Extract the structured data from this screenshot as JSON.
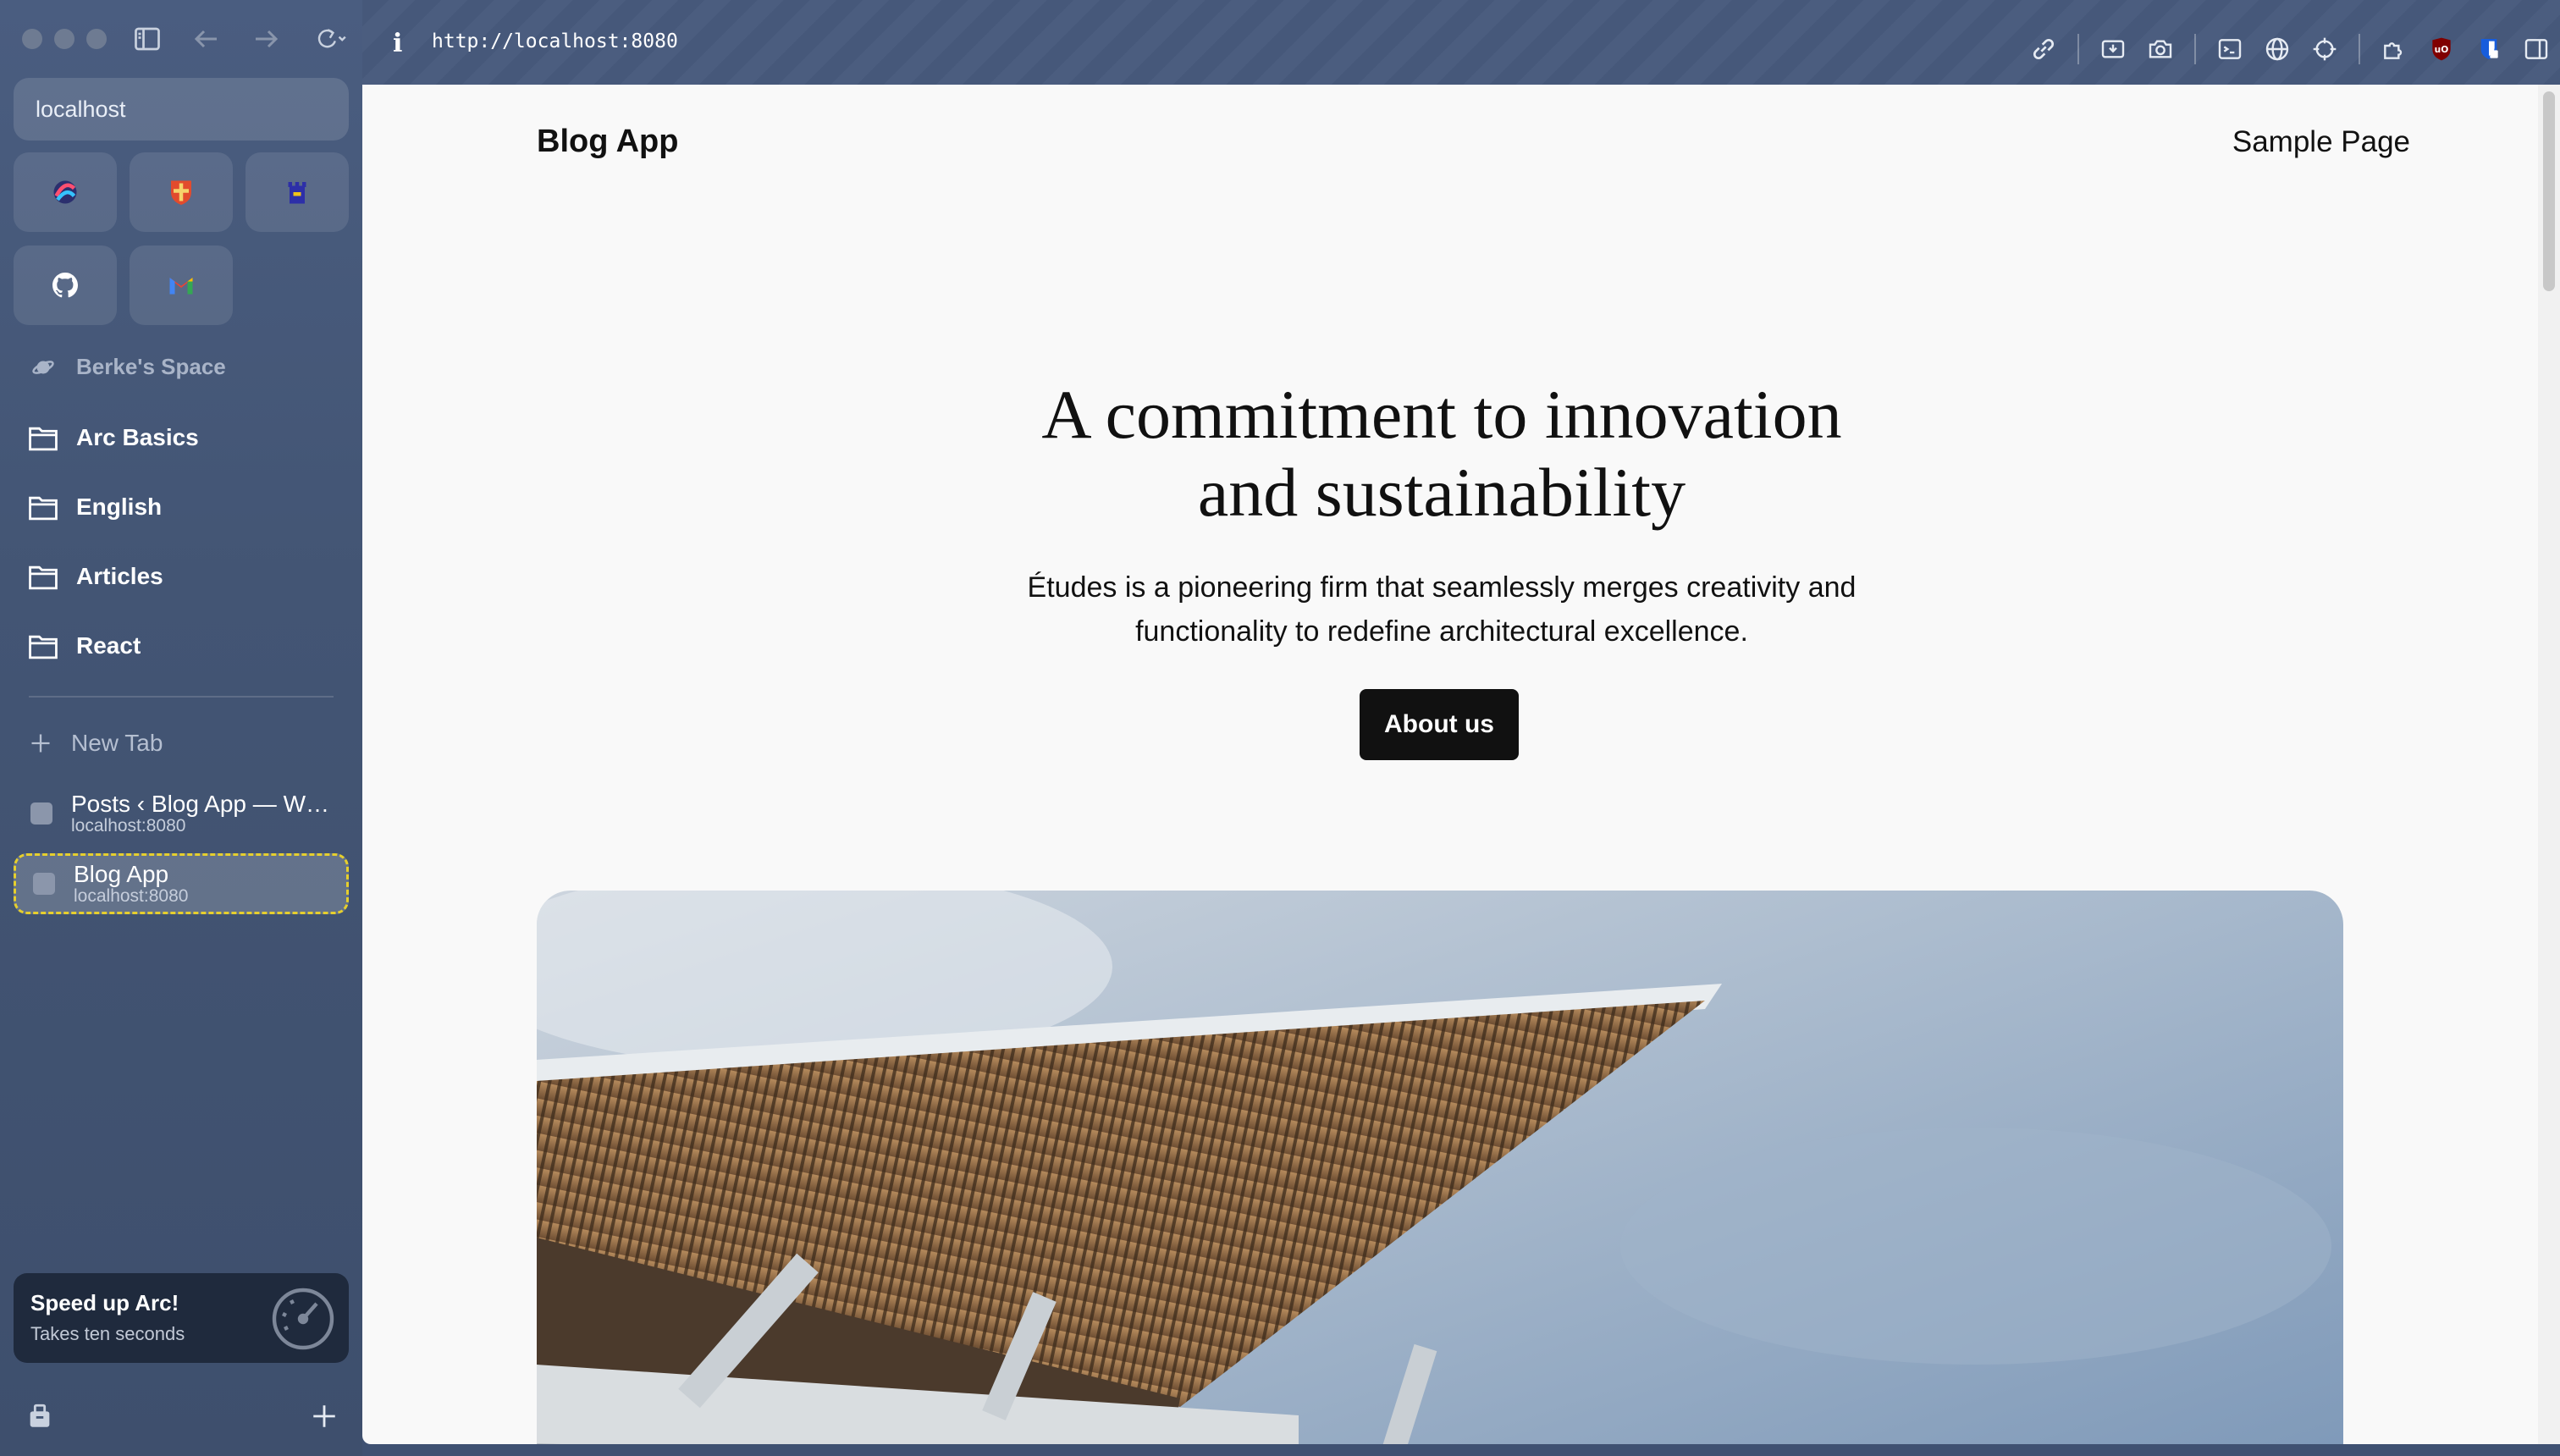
{
  "sidebar": {
    "url_text": "localhost",
    "space_name": "Berke's Space",
    "folders": [
      "Arc Basics",
      "English",
      "Articles",
      "React"
    ],
    "new_tab_label": "New Tab",
    "tabs": [
      {
        "title": "Posts ‹ Blog App — W…",
        "subtitle": "localhost:8080"
      },
      {
        "title": "Blog App",
        "subtitle": "localhost:8080"
      }
    ],
    "promo": {
      "title": "Speed up Arc!",
      "subtitle": "Takes ten seconds"
    }
  },
  "toolbar": {
    "info_icon": "i",
    "url": "http://localhost:8080"
  },
  "page": {
    "site_title": "Blog App",
    "nav_link": "Sample Page",
    "hero_title_line1": "A commitment to innovation",
    "hero_title_line2": "and sustainability",
    "hero_desc_line1": "Études is a pioneering firm that seamlessly merges creativity and",
    "hero_desc_line2": "functionality to redefine architectural excellence.",
    "button_label": "About us"
  },
  "colors": {
    "sidebar_bg": "#435574",
    "active_tab_border": "#e6cf2d",
    "page_bg": "#f9f9f9",
    "button_bg": "#111111"
  }
}
